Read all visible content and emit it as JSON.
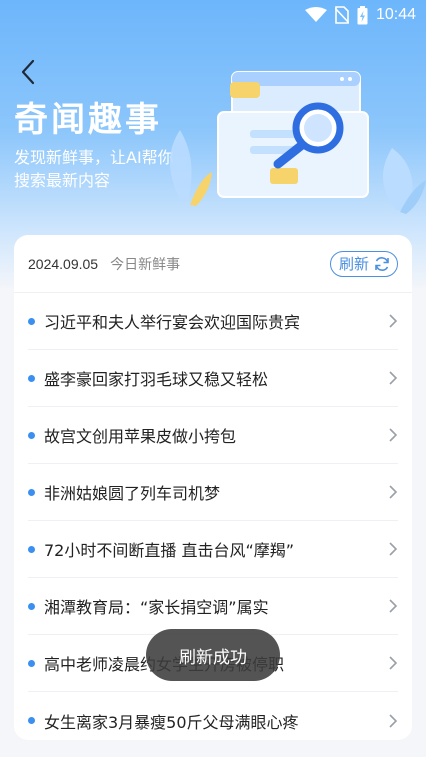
{
  "status_bar": {
    "time": "10:44",
    "icons": [
      "wifi-icon",
      "no-sim-icon",
      "battery-charging-icon"
    ]
  },
  "header": {
    "back_icon": "chevron-left-icon",
    "title": "奇闻趣事",
    "subtitle": "发现新鲜事，让AI帮你搜索最新内容"
  },
  "card": {
    "date": "2024.09.05",
    "tag": "今日新鲜事",
    "refresh_label": "刷新",
    "items": [
      {
        "title": "习近平和夫人举行宴会欢迎国际贵宾"
      },
      {
        "title": "盛李豪回家打羽毛球又稳又轻松"
      },
      {
        "title": "故宫文创用苹果皮做小挎包"
      },
      {
        "title": "非洲姑娘圆了列车司机梦"
      },
      {
        "title": "72小时不间断直播 直击台风“摩羯”"
      },
      {
        "title": "湘潭教育局：“家长捐空调”属实"
      },
      {
        "title": "高中老师凌晨约女学生开房被停职"
      },
      {
        "title": "女生离家3月暴瘦50斤父母满眼心疼"
      }
    ]
  },
  "toast": {
    "text": "刷新成功"
  },
  "colors": {
    "accent": "#4a90e2",
    "dot": "#3b8ff0",
    "hero_top": "#6db6fb"
  }
}
